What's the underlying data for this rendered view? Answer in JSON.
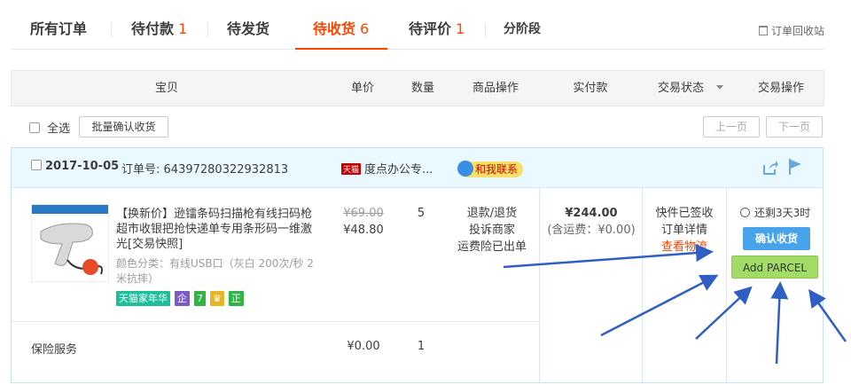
{
  "tabs": [
    {
      "label": "所有订单",
      "count": ""
    },
    {
      "label": "待付款",
      "count": "1"
    },
    {
      "label": "待发货",
      "count": ""
    },
    {
      "label": "待收货",
      "count": "6"
    },
    {
      "label": "待评价",
      "count": "1"
    },
    {
      "label": "分阶段",
      "count": ""
    }
  ],
  "recycle_label": "订单回收站",
  "columns": {
    "item": "宝贝",
    "price": "单价",
    "qty": "数量",
    "ops": "商品操作",
    "paid": "实付款",
    "status": "交易状态",
    "action": "交易操作"
  },
  "toolbar": {
    "select_all": "全选",
    "batch_confirm": "批量确认收货",
    "prev": "上一页",
    "next": "下一页"
  },
  "order": {
    "date": "2017-10-05",
    "order_no_label": "订单号:",
    "order_no": "64397280322932813",
    "shop_badge": "天猫",
    "shop": "度点办公专...",
    "contact": "和我联系",
    "product": {
      "title": "【换新价】逊镭条码扫描枪有线扫码枪超市收银把抢快递单专用条形码一维激光[交易快照]",
      "color": "颜色分类：有线USB口（灰白 200次/秒 2米抗摔）",
      "badges": [
        "天猫家年华",
        "企",
        "7",
        "♛",
        "正"
      ],
      "orig_price": "¥69.00",
      "price": "¥48.80",
      "qty": "5",
      "ops": [
        "退款/退货",
        "投诉商家",
        "运费险已出单"
      ]
    },
    "paid": "¥244.00",
    "shipping": "(含运费：¥0.00)",
    "status": [
      "快件已签收",
      "订单详情",
      "查看物流"
    ],
    "timer": "还剩3天3时",
    "confirm_btn": "确认收货",
    "parcel_btn": "Add PARCEL",
    "insurance": {
      "name": "保险服务",
      "price": "¥0.00",
      "qty": "1"
    }
  },
  "colors": {
    "accent": "#ff4400",
    "confirm": "#47a3ec",
    "parcel": "#a2dc67",
    "arrow": "#2f5fc4"
  }
}
